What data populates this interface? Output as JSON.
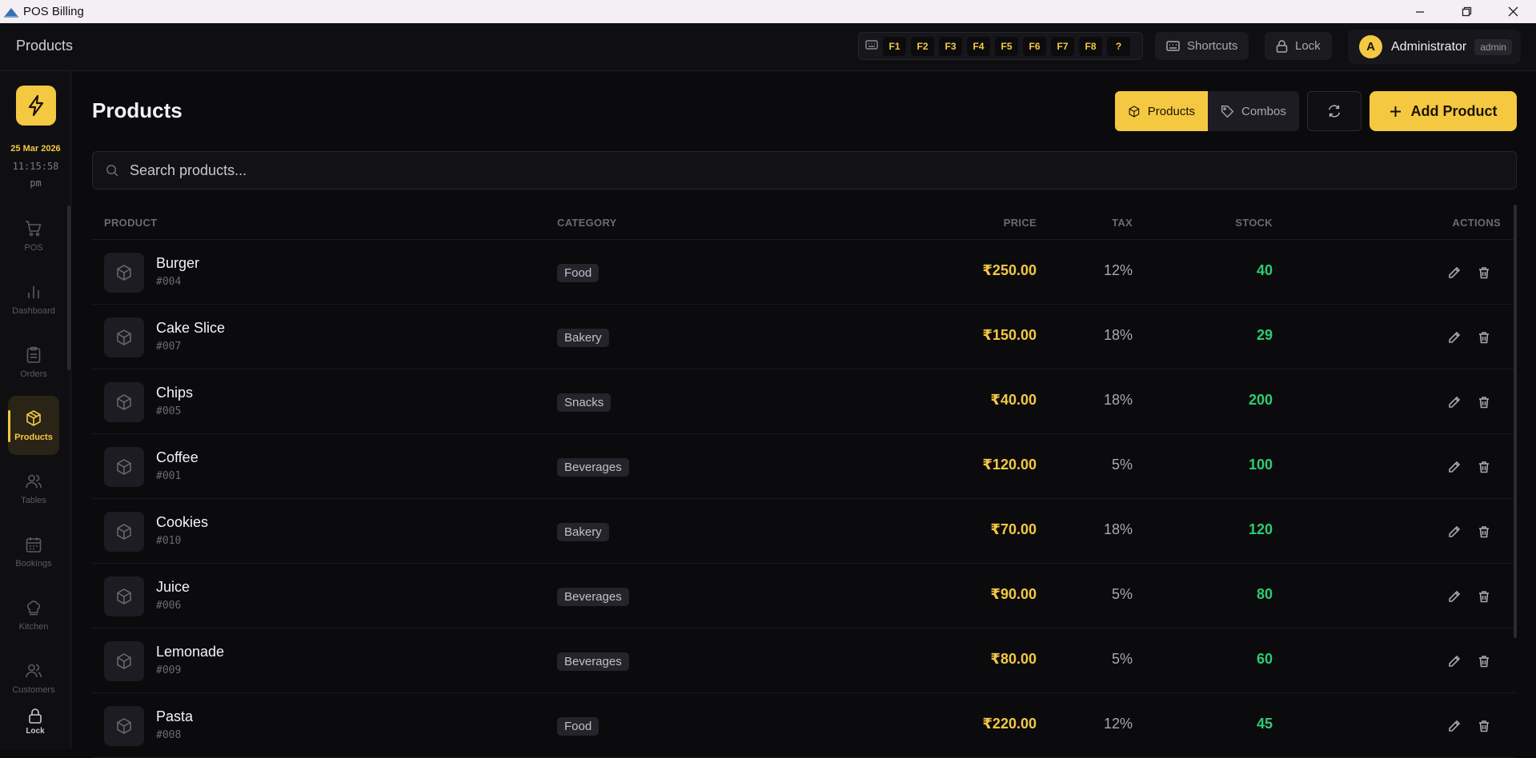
{
  "window": {
    "title": "POS Billing"
  },
  "header": {
    "page_label": "Products",
    "fkeys": [
      "F1",
      "F2",
      "F3",
      "F4",
      "F5",
      "F6",
      "F7",
      "F8",
      "?"
    ],
    "shortcuts_label": "Shortcuts",
    "lock_label": "Lock",
    "user": {
      "initial": "A",
      "name": "Administrator",
      "role": "admin"
    }
  },
  "sidebar": {
    "date": "25 Mar 2026",
    "time_line1": "11:15:58",
    "time_line2": "pm",
    "items": [
      {
        "label": "POS",
        "icon": "cart-icon"
      },
      {
        "label": "Dashboard",
        "icon": "bar-chart-icon"
      },
      {
        "label": "Orders",
        "icon": "clipboard-icon"
      },
      {
        "label": "Products",
        "icon": "box-icon",
        "active": true
      },
      {
        "label": "Tables",
        "icon": "users-icon"
      },
      {
        "label": "Bookings",
        "icon": "calendar-icon"
      },
      {
        "label": "Kitchen",
        "icon": "chef-hat-icon"
      },
      {
        "label": "Customers",
        "icon": "customers-icon"
      }
    ],
    "lock_label": "Lock"
  },
  "main": {
    "title": "Products",
    "toggle": {
      "products": "Products",
      "combos": "Combos"
    },
    "add_label": "Add Product",
    "search_placeholder": "Search products...",
    "columns": {
      "product": "PRODUCT",
      "category": "CATEGORY",
      "price": "PRICE",
      "tax": "TAX",
      "stock": "STOCK",
      "actions": "ACTIONS"
    },
    "rows": [
      {
        "name": "Burger",
        "code": "#004",
        "category": "Food",
        "price": "₹250.00",
        "tax": "12%",
        "stock": "40"
      },
      {
        "name": "Cake Slice",
        "code": "#007",
        "category": "Bakery",
        "price": "₹150.00",
        "tax": "18%",
        "stock": "29"
      },
      {
        "name": "Chips",
        "code": "#005",
        "category": "Snacks",
        "price": "₹40.00",
        "tax": "18%",
        "stock": "200"
      },
      {
        "name": "Coffee",
        "code": "#001",
        "category": "Beverages",
        "price": "₹120.00",
        "tax": "5%",
        "stock": "100"
      },
      {
        "name": "Cookies",
        "code": "#010",
        "category": "Bakery",
        "price": "₹70.00",
        "tax": "18%",
        "stock": "120"
      },
      {
        "name": "Juice",
        "code": "#006",
        "category": "Beverages",
        "price": "₹90.00",
        "tax": "5%",
        "stock": "80"
      },
      {
        "name": "Lemonade",
        "code": "#009",
        "category": "Beverages",
        "price": "₹80.00",
        "tax": "5%",
        "stock": "60"
      },
      {
        "name": "Pasta",
        "code": "#008",
        "category": "Food",
        "price": "₹220.00",
        "tax": "12%",
        "stock": "45"
      }
    ]
  },
  "colors": {
    "accent": "#f5c842",
    "stock": "#2ecc71",
    "background": "#0b0b0d"
  }
}
